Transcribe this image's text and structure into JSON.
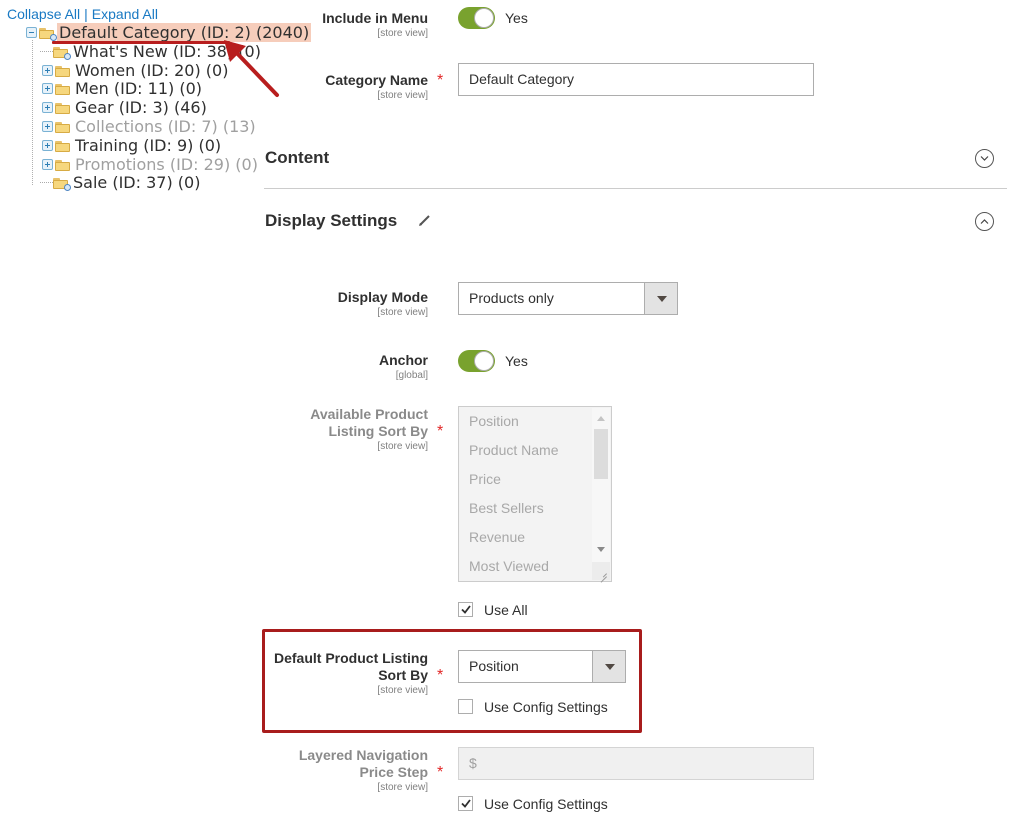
{
  "tree": {
    "collapse_all": "Collapse All",
    "separator": "|",
    "expand_all": "Expand All",
    "nodes": [
      {
        "label": "Default Category (ID: 2) (2040)",
        "state": "selected",
        "expander": "minus",
        "icon": "folder-search"
      },
      {
        "label": "What's New (ID: 38) (0)",
        "state": "normal",
        "expander": "none",
        "icon": "folder-search"
      },
      {
        "label": "Women (ID: 20) (0)",
        "state": "normal",
        "expander": "plus",
        "icon": "folder"
      },
      {
        "label": "Men (ID: 11) (0)",
        "state": "normal",
        "expander": "plus",
        "icon": "folder"
      },
      {
        "label": "Gear (ID: 3) (46)",
        "state": "normal",
        "expander": "plus",
        "icon": "folder"
      },
      {
        "label": "Collections (ID: 7) (13)",
        "state": "disabled",
        "expander": "plus",
        "icon": "folder"
      },
      {
        "label": "Training (ID: 9) (0)",
        "state": "normal",
        "expander": "plus",
        "icon": "folder"
      },
      {
        "label": "Promotions (ID: 29) (0)",
        "state": "disabled",
        "expander": "plus",
        "icon": "folder"
      },
      {
        "label": "Sale (ID: 37) (0)",
        "state": "normal",
        "expander": "none",
        "icon": "folder-search"
      }
    ]
  },
  "form": {
    "include_in_menu": {
      "label": "Include in Menu",
      "scope": "[store view]",
      "value": "Yes",
      "enabled": true
    },
    "category_name": {
      "label": "Category Name",
      "scope": "[store view]",
      "value": "Default Category",
      "required": "*"
    },
    "content_section": {
      "title": "Content",
      "expanded": false
    },
    "display_settings_section": {
      "title": "Display Settings",
      "expanded": true
    },
    "display_mode": {
      "label": "Display Mode",
      "scope": "[store view]",
      "value": "Products only"
    },
    "anchor": {
      "label": "Anchor",
      "scope": "[global]",
      "value": "Yes",
      "enabled": true
    },
    "available_sort_by": {
      "label_line1": "Available Product",
      "label_line2": "Listing Sort By",
      "scope": "[store view]",
      "required": "*",
      "options": [
        "Position",
        "Product Name",
        "Price",
        "Best Sellers",
        "Revenue",
        "Most Viewed"
      ],
      "use_all_label": "Use All",
      "use_all_checked": true
    },
    "default_sort_by": {
      "label_line1": "Default Product Listing",
      "label_line2": "Sort By",
      "scope": "[store view]",
      "required": "*",
      "value": "Position",
      "use_config_label": "Use Config Settings",
      "use_config_checked": false
    },
    "price_step": {
      "label_line1": "Layered Navigation",
      "label_line2": "Price Step",
      "scope": "[store view]",
      "required": "*",
      "placeholder": "$",
      "use_config_label": "Use Config Settings",
      "use_config_checked": true
    }
  },
  "colors": {
    "toggle_on": "#79a22e",
    "link": "#1979c3",
    "required": "#e22626",
    "annotation_red": "#a81c1c",
    "selected_node_bg": "#f6cdbb"
  }
}
